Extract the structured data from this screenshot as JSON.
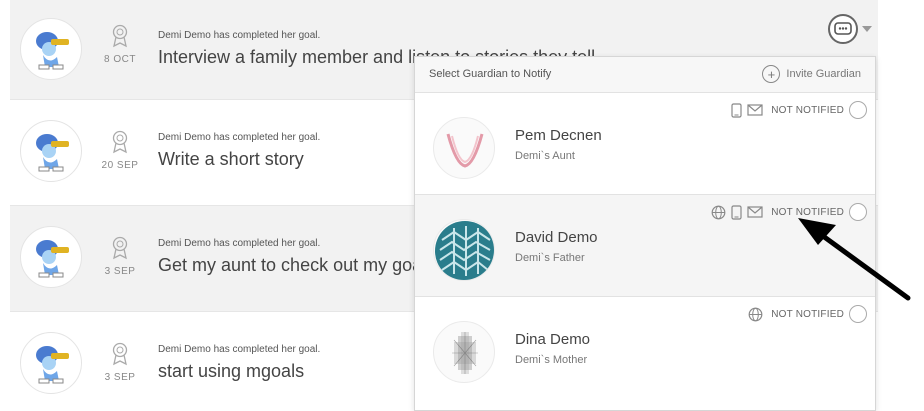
{
  "feed": [
    {
      "meta": "Demi Demo has completed her goal.",
      "title": "Interview a family member and listen to stories they tell",
      "date": "8 OCT"
    },
    {
      "meta": "Demi Demo has completed her goal.",
      "title": "Write a short story",
      "date": "20 SEP"
    },
    {
      "meta": "Demi Demo has completed her goal.",
      "title": "Get my aunt to check out my goals",
      "date": "3 SEP"
    },
    {
      "meta": "Demi Demo has completed her goal.",
      "title": "start using mgoals",
      "date": "3 SEP"
    }
  ],
  "dropdown": {
    "header": "Select Guardian to Notify",
    "invite": "Invite Guardian",
    "guardians": [
      {
        "name": "Pem Decnen",
        "relation": "Demi`s Aunt",
        "status": "NOT NOTIFIED",
        "icons": [
          "mobile-icon",
          "mail-icon"
        ]
      },
      {
        "name": "David Demo",
        "relation": "Demi`s Father",
        "status": "NOT NOTIFIED",
        "icons": [
          "globe-icon",
          "mobile-icon",
          "mail-icon"
        ]
      },
      {
        "name": "Dina Demo",
        "relation": "Demi`s Mother",
        "status": "NOT NOTIFIED",
        "icons": [
          "globe-icon"
        ]
      }
    ]
  },
  "colors": {
    "row_alt": "#f2f2f2",
    "arrow": "#000000",
    "accent_pink": "#e39aa8",
    "pattern_teal": "#2a7d8c"
  }
}
